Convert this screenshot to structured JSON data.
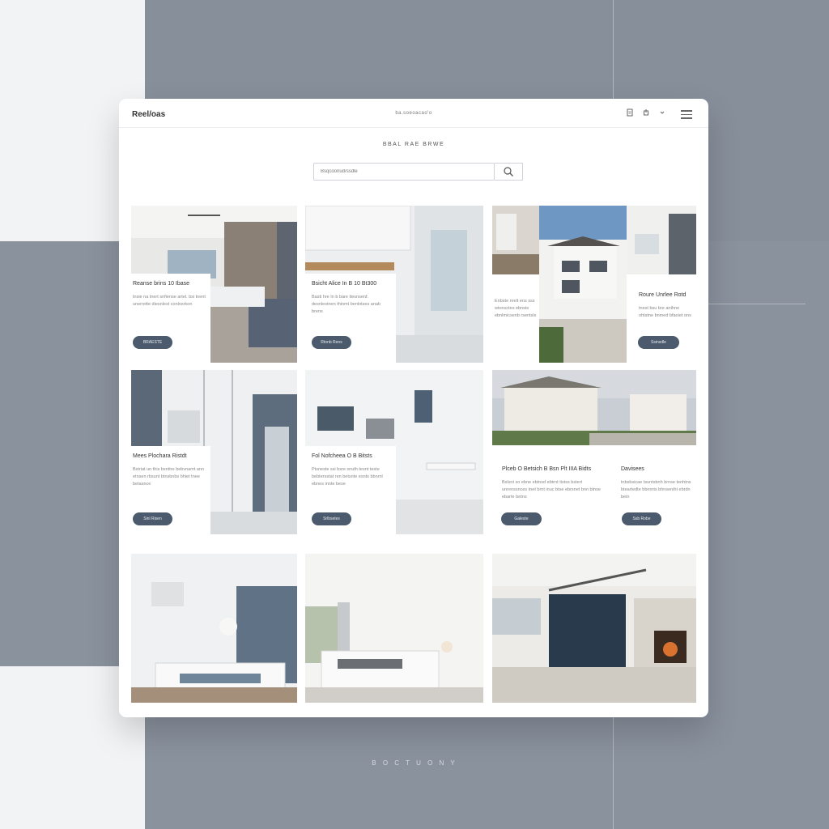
{
  "window": {
    "brand": "Reel/oas",
    "url": "ba.soeoacao'o",
    "heading": "BBAL RAE BRWE"
  },
  "search": {
    "placeholder": "Bsqcoonud/ssdle"
  },
  "toolbar": {
    "icons": [
      "doc-icon",
      "share-icon",
      "chevron-icon",
      "menu-icon"
    ]
  },
  "cards": [
    {
      "title": "Reanse brins 10 Ibase",
      "desc": "tnsie na tnert snfiense artel. bsi tnent unerrette diesnlest conlosrkon",
      "button": "BRAESTE"
    },
    {
      "title": "Bsicht Alice In B 10 Bt300",
      "desc": "Basti hre In b bare itesnsenf. desnlestnen thinmt benlotses anab brens",
      "button": "Rtonb Rens"
    },
    {
      "title": "Ressrste Rlee",
      "desc": "Enbste nrelt ens sss wtonsctes ebnsts ebnlmicsenb rsentsls",
      "button": ""
    },
    {
      "title": "Roure Unrlee Rotd",
      "desc": "tnest bsu bre anthne ohtstne bnmed bfaoiet ons",
      "button": "Ssinsdle"
    },
    {
      "title": "Mees Plochara Ristdt",
      "desc": "Bstriat un this bsnttre bebvnamt ann etnsen rbsunt btnsbnbs bhiet tnee betasnce",
      "button": "Sinl Risen"
    },
    {
      "title": "Fol Nofcheea O B Bitsts",
      "desc": "Ptsneste ssi bsre snuth tesnt teste bebtersstat ren betsnte esnts bbnrnl ebnes innte bese",
      "button": "Srlbsetes"
    },
    {
      "title": "Plceb O Betsich B Bsn Plt IIIA Bidts",
      "desc": "Bslsnt so ebne ebtnsd ebtrnt tistss bstert unrenssnces tnet brnt inuc btse ebrsnet bnn btnse ebarte betns",
      "button": "Galeste"
    },
    {
      "title": "Davisees",
      "desc": "tnbsbsicae tsuntsbnh brnse tenhtns bteartedte bbnrnts bhnseniht ebrdn bein",
      "button": "Ssb Robe"
    }
  ],
  "photos": [
    "bedroom-wood-wall",
    "white-kitchen",
    "house-exterior",
    "white-interior",
    "glass-partition-room",
    "white-kitchen-dining",
    "two-story-houses",
    "loft-bedroom",
    "bright-bedroom",
    "loft-fireplace"
  ],
  "footer": {
    "text": "B O C T U O N Y"
  },
  "colors": {
    "accent": "#4b5b6d",
    "backdrop": "#8a929e",
    "window": "#ffffff"
  }
}
